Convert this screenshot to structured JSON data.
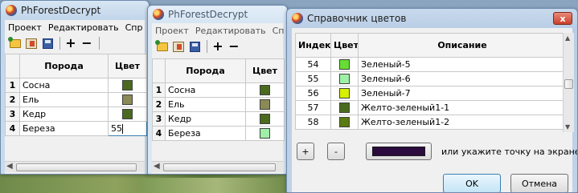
{
  "colors": {
    "green_dark": "#4b6a1f",
    "olive": "#8a8a56",
    "light_green": "#9ef0a6",
    "green_bright": "#66dd33",
    "chartreuse": "#d6f000",
    "yellow_green_dark": "#5a7a12",
    "dark_purple": "#2b0a3d"
  },
  "window1": {
    "title": "PhForestDecrypt",
    "menu": [
      "Проект",
      "Редактировать",
      "Спр"
    ],
    "toolbar": {
      "open_icon": "open-folder-icon",
      "edit_icon": "edit-layers-icon",
      "save_icon": "save-disk-icon",
      "add": "+",
      "remove": "−"
    },
    "table": {
      "headers": {
        "num": "",
        "breed": "Порода",
        "color": "Цвет"
      },
      "rows": [
        {
          "num": "1",
          "breed": "Сосна",
          "color_value": "#4b6a1f"
        },
        {
          "num": "2",
          "breed": "Ель",
          "color_value": "#8a8a56"
        },
        {
          "num": "3",
          "breed": "Кедр",
          "color_value": "#4b6a1f"
        },
        {
          "num": "4",
          "breed": "Береза",
          "color_text": "55"
        }
      ]
    }
  },
  "window2": {
    "title": "PhForestDecrypt",
    "menu": [
      "Проект",
      "Редактировать",
      "Сп"
    ],
    "toolbar": {
      "add": "+",
      "remove": "−"
    },
    "table": {
      "headers": {
        "num": "",
        "breed": "Порода",
        "color": "Цвет"
      },
      "rows": [
        {
          "num": "1",
          "breed": "Сосна",
          "color_value": "#4b6a1f"
        },
        {
          "num": "2",
          "breed": "Ель",
          "color_value": "#8a8a56"
        },
        {
          "num": "3",
          "breed": "Кедр",
          "color_value": "#4b6a1f"
        },
        {
          "num": "4",
          "breed": "Береза",
          "color_value": "#9ef0a6"
        }
      ]
    }
  },
  "dialog": {
    "title": "Справочник цветов",
    "close_label": "x",
    "headers": {
      "index": "Индекс",
      "color": "Цвет",
      "description": "Описание"
    },
    "rows": [
      {
        "index": "54",
        "color_value": "#66dd33",
        "description": "Зеленый-5"
      },
      {
        "index": "55",
        "color_value": "#9ef0a6",
        "description": "Зеленый-6"
      },
      {
        "index": "56",
        "color_value": "#d6f000",
        "description": "Зеленый-7"
      },
      {
        "index": "57",
        "color_value": "#4b6a1f",
        "description": "Желто-зеленый1-1"
      },
      {
        "index": "58",
        "color_value": "#5a7a12",
        "description": "Желто-зеленый1-2"
      }
    ],
    "add_label": "+",
    "remove_label": "-",
    "picked_color": "#2b0a3d",
    "hint": "или  укажите точку на экране",
    "ok_label": "OK",
    "cancel_label": "Отмена"
  }
}
